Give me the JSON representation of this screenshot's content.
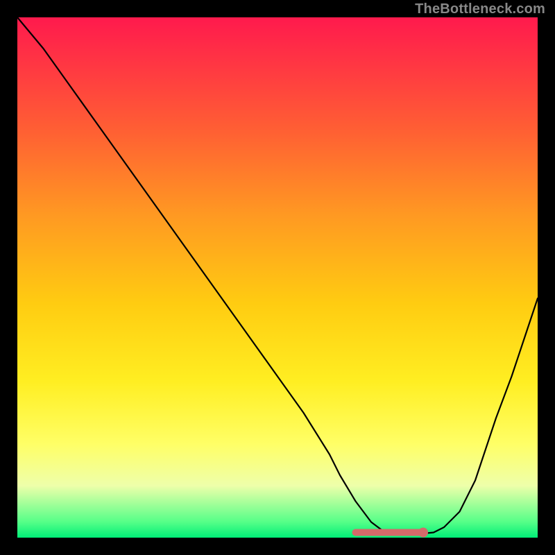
{
  "watermark": "TheBottleneck.com",
  "colors": {
    "background": "#000000",
    "curve": "#000000",
    "marker_stroke": "#d46a6a",
    "marker_fill": "#d46a6a",
    "gradient_top": "#ff1a4d",
    "gradient_bottom": "#00ee77"
  },
  "chart_data": {
    "type": "line",
    "title": "",
    "xlabel": "",
    "ylabel": "",
    "xlim": [
      0,
      100
    ],
    "ylim": [
      0,
      100
    ],
    "grid": false,
    "legend_position": "none",
    "series": [
      {
        "name": "bottleneck-curve",
        "x": [
          0,
          5,
          10,
          15,
          20,
          25,
          30,
          35,
          40,
          45,
          50,
          55,
          60,
          62,
          65,
          68,
          70,
          72,
          75,
          78,
          80,
          82,
          85,
          88,
          90,
          92,
          95,
          98,
          100
        ],
        "values": [
          100,
          94,
          87,
          80,
          73,
          66,
          59,
          52,
          45,
          38,
          31,
          24,
          16,
          12,
          7,
          3,
          1.5,
          1,
          0.8,
          0.8,
          1,
          2,
          5,
          11,
          17,
          23,
          31,
          40,
          46
        ]
      }
    ],
    "markers": [
      {
        "name": "sweetspot-range",
        "x_from": 65,
        "x_to": 78,
        "y": 1
      },
      {
        "name": "sweetspot-point",
        "x": 78,
        "y": 1
      }
    ],
    "note": "x/y are percentage coordinates of the plot area; values estimated from gridless chart"
  }
}
